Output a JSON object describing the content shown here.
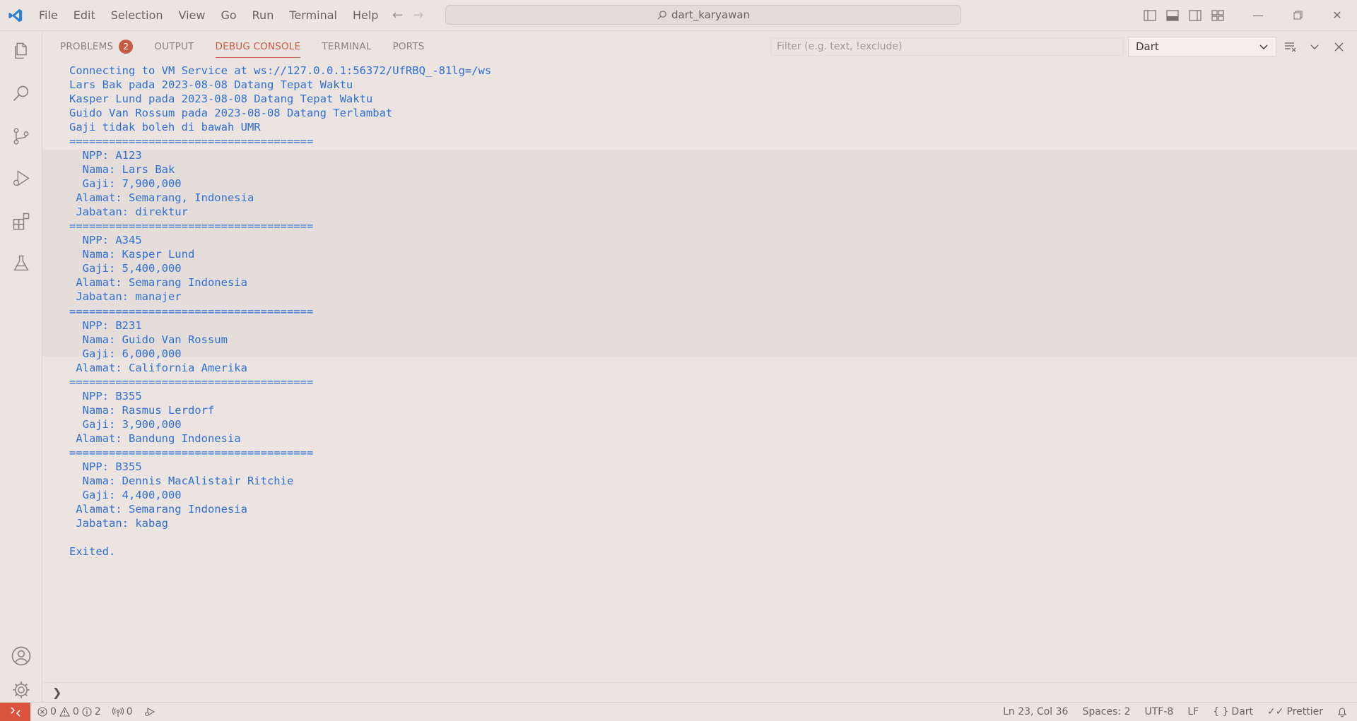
{
  "window": {
    "command_center": "dart_karyawan"
  },
  "menu": [
    "File",
    "Edit",
    "Selection",
    "View",
    "Go",
    "Run",
    "Terminal",
    "Help"
  ],
  "panel": {
    "tabs": [
      {
        "label": "PROBLEMS",
        "badge": "2"
      },
      {
        "label": "OUTPUT"
      },
      {
        "label": "DEBUG CONSOLE",
        "active": true
      },
      {
        "label": "TERMINAL"
      },
      {
        "label": "PORTS"
      }
    ],
    "filter_placeholder": "Filter (e.g. text, !exclude)",
    "selected_session": "Dart"
  },
  "console": {
    "lines": [
      "Connecting to VM Service at ws://127.0.0.1:56372/UfRBQ_-81lg=/ws",
      "Lars Bak pada 2023-08-08 Datang Tepat Waktu",
      "Kasper Lund pada 2023-08-08 Datang Tepat Waktu",
      "Guido Van Rossum pada 2023-08-08 Datang Terlambat",
      "Gaji tidak boleh di bawah UMR",
      "=====================================",
      "  NPP: A123",
      "  Nama: Lars Bak",
      "  Gaji: 7,900,000",
      " Alamat: Semarang, Indonesia",
      " Jabatan: direktur",
      "=====================================",
      "  NPP: A345",
      "  Nama: Kasper Lund",
      "  Gaji: 5,400,000",
      " Alamat: Semarang Indonesia",
      " Jabatan: manajer",
      "=====================================",
      "  NPP: B231",
      "  Nama: Guido Van Rossum",
      "  Gaji: 6,000,000",
      " Alamat: California Amerika",
      "=====================================",
      "  NPP: B355",
      "  Nama: Rasmus Lerdorf",
      "  Gaji: 3,900,000",
      " Alamat: Bandung Indonesia",
      "=====================================",
      "  NPP: B355",
      "  Nama: Dennis MacAlistair Ritchie",
      "  Gaji: 4,400,000",
      " Alamat: Semarang Indonesia",
      " Jabatan: kabag",
      "",
      "Exited."
    ]
  },
  "statusbar": {
    "errors": "0",
    "warnings": "0",
    "infos": "2",
    "ports": "0",
    "cursor": "Ln 23, Col 36",
    "spaces": "Spaces: 2",
    "encoding": "UTF-8",
    "eol": "LF",
    "language": "Dart",
    "formatter": "Prettier"
  },
  "colors": {
    "accent": "#c95a45",
    "console_text": "#2f6fd6",
    "remote_button": "#d9533f",
    "vscode_logo": "#2f80d1"
  },
  "icons": {
    "activity_bar": [
      "explorer-icon",
      "search-icon",
      "source-control-icon",
      "run-debug-icon",
      "extensions-icon",
      "testing-icon",
      "account-icon",
      "manage-gear-icon"
    ]
  }
}
